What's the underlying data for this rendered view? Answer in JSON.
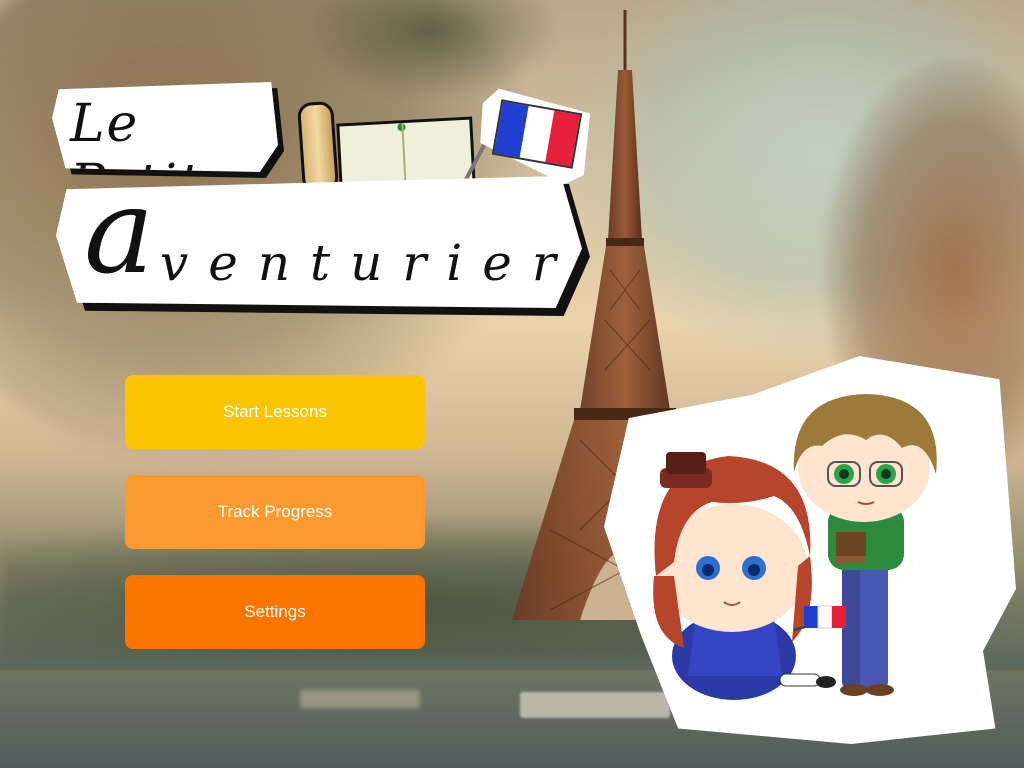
{
  "app": {
    "title_line1": "Le Petit",
    "title_line2_initial": "a",
    "title_line2_rest": "venturier"
  },
  "menu": {
    "start_label": "Start Lessons",
    "track_label": "Track Progress",
    "settings_label": "Settings"
  },
  "colors": {
    "start": "#fbc400",
    "track": "#fb9a30",
    "settings": "#fb7500"
  },
  "icons": {
    "baguette": "baguette-icon",
    "book": "book-icon",
    "flag": "french-flag-icon",
    "tower": "eiffel-tower-illustration",
    "characters": "characters-illustration"
  }
}
